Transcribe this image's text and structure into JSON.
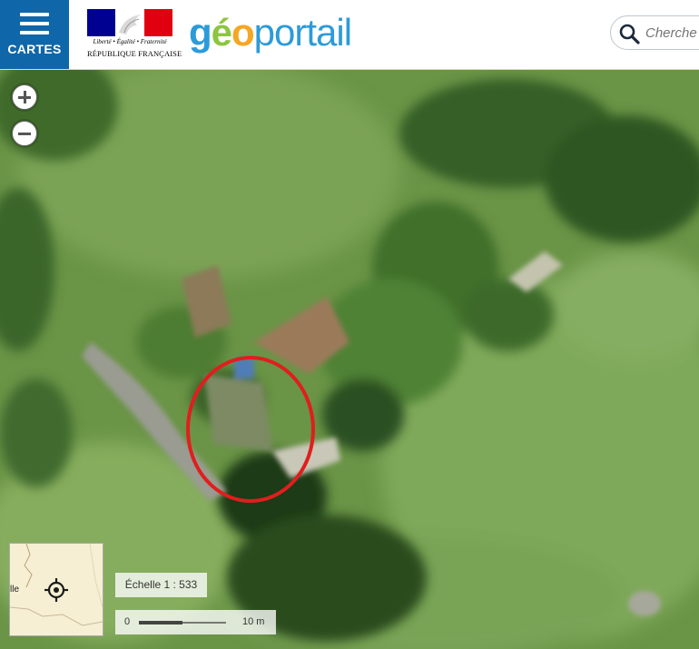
{
  "header": {
    "menu_label": "CARTES",
    "logo_motto": "Liberté • Égalité • Fraternité",
    "logo_name": "RÉPUBLIQUE FRANÇAISE",
    "brand_g": "g",
    "brand_e": "é",
    "brand_o": "o",
    "brand_rest": "portail",
    "search_placeholder": "Cherche"
  },
  "map_controls": {
    "zoom_in_icon": "plus-icon",
    "zoom_out_icon": "minus-icon"
  },
  "minimap": {
    "label": "lle",
    "locate_icon": "crosshair-icon"
  },
  "scale": {
    "ratio_text": "Échelle 1 : 533",
    "bar_start": "0",
    "bar_end": "10 m"
  },
  "colors": {
    "header_blue": "#0f66a8",
    "brand_blue": "#2d9bd8",
    "brand_green": "#8cc63f",
    "brand_orange": "#f5a623",
    "highlight_circle": "#e01e1e",
    "flag_blue": "#000091",
    "flag_red": "#e1000f"
  }
}
